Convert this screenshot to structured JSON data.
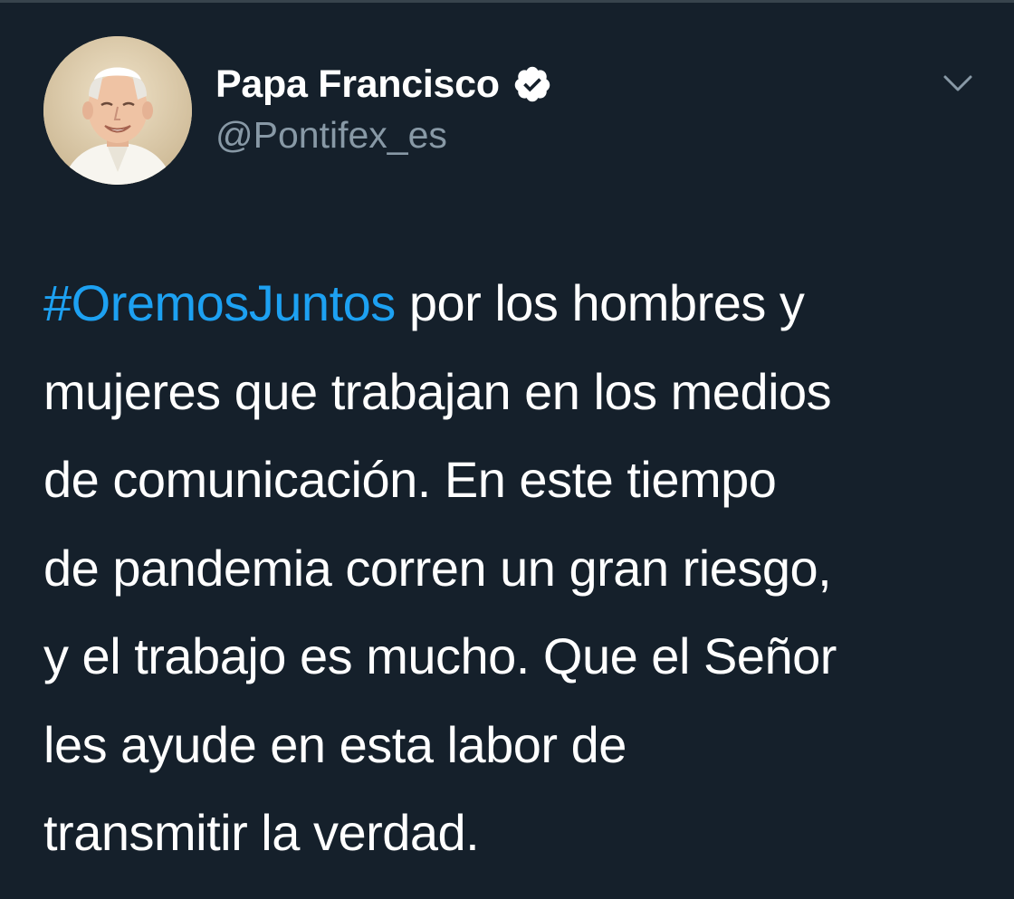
{
  "tweet": {
    "author": {
      "display_name": "Papa Francisco",
      "handle": "@Pontifex_es",
      "verified": true,
      "verified_icon": "verified-badge-icon"
    },
    "menu_icon": "chevron-down-icon",
    "text": {
      "hashtag": "#OremosJuntos",
      "lines": [
        " por los hombres y",
        "mujeres que trabajan en los medios",
        "de comunicación. En este tiempo",
        "de pandemia corren un gran riesgo,",
        "y el trabajo es mucho. Que el Señor",
        "les ayude en esta labor de",
        "transmitir la verdad."
      ]
    }
  },
  "colors": {
    "background": "#15202b",
    "text_primary": "#ffffff",
    "text_secondary": "#8899a6",
    "link": "#1da1f2"
  }
}
